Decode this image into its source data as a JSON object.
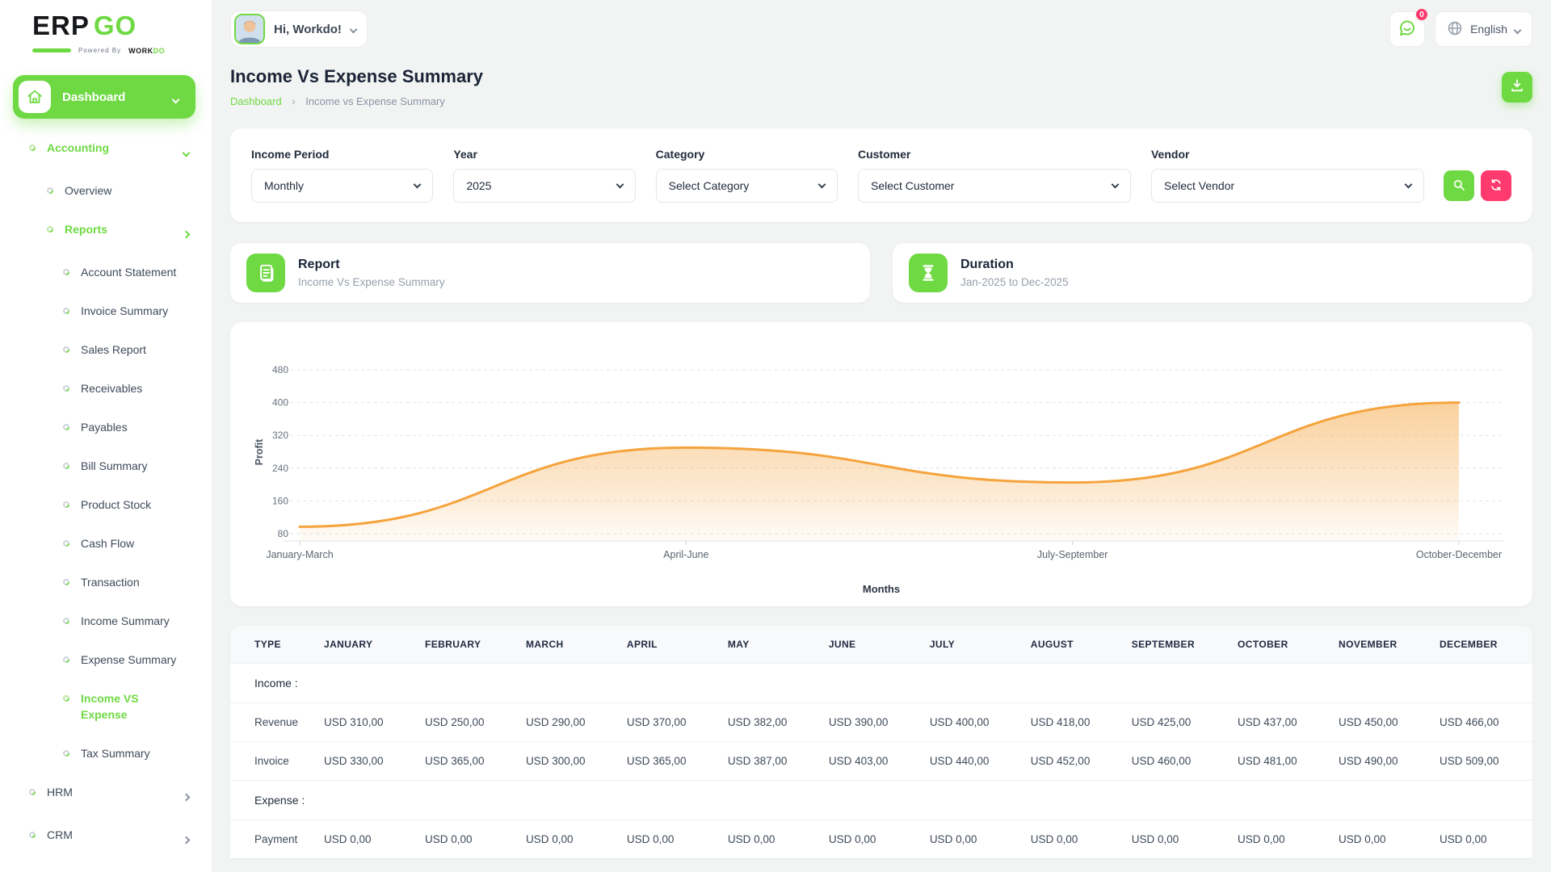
{
  "colors": {
    "primary": "#6fd943",
    "danger": "#ff3a6e",
    "chart_line": "#f5a33c",
    "grid": "#e2e4e6",
    "tick_text": "#6a7280"
  },
  "brand": {
    "erp": "ERP",
    "go": "GO",
    "powered_prefix": "Powered By",
    "powered_work": "WORK",
    "powered_do": "DO"
  },
  "header": {
    "greeting": "Hi, Workdo!",
    "notification_count": "0",
    "language": "English"
  },
  "sidebar": {
    "dashboard_label": "Dashboard",
    "items": [
      {
        "label": "Accounting",
        "level": 1,
        "active": true,
        "chevron": "down"
      },
      {
        "label": "Overview",
        "level": 2
      },
      {
        "label": "Reports",
        "level": 2,
        "active": true,
        "chevron": "right"
      },
      {
        "label": "Account Statement",
        "level": 3
      },
      {
        "label": "Invoice Summary",
        "level": 3
      },
      {
        "label": "Sales Report",
        "level": 3
      },
      {
        "label": "Receivables",
        "level": 3
      },
      {
        "label": "Payables",
        "level": 3
      },
      {
        "label": "Bill Summary",
        "level": 3
      },
      {
        "label": "Product Stock",
        "level": 3
      },
      {
        "label": "Cash Flow",
        "level": 3
      },
      {
        "label": "Transaction",
        "level": 3
      },
      {
        "label": "Income Summary",
        "level": 3
      },
      {
        "label": "Expense Summary",
        "level": 3
      },
      {
        "label": "Income VS Expense",
        "level": 3,
        "active": true
      },
      {
        "label": "Tax Summary",
        "level": 3
      },
      {
        "label": "HRM",
        "level": 1,
        "chevron": "right"
      },
      {
        "label": "CRM",
        "level": 1,
        "chevron": "right"
      }
    ]
  },
  "page": {
    "title": "Income Vs Expense Summary",
    "breadcrumb_home": "Dashboard",
    "breadcrumb_separator": "›",
    "breadcrumb_current": "Income vs Expense Summary"
  },
  "filters": {
    "fields": [
      {
        "label": "Income Period",
        "value": "Monthly"
      },
      {
        "label": "Year",
        "value": "2025"
      },
      {
        "label": "Category",
        "value": "Select Category"
      },
      {
        "label": "Customer",
        "value": "Select Customer"
      },
      {
        "label": "Vendor",
        "value": "Select Vendor"
      }
    ]
  },
  "cards": {
    "report": {
      "title": "Report",
      "subtitle": "Income Vs Expense Summary"
    },
    "duration": {
      "title": "Duration",
      "subtitle": "Jan-2025 to Dec-2025"
    }
  },
  "chart_data": {
    "type": "area",
    "x": [
      "January-March",
      "April-June",
      "July-September",
      "October-December"
    ],
    "series": [
      {
        "name": "Profit",
        "values": [
          97,
          290,
          205,
          400
        ]
      }
    ],
    "xlabel": "Months",
    "ylabel": "Profit",
    "yticks": [
      80,
      160,
      240,
      320,
      400,
      480
    ],
    "ylim": [
      60,
      520
    ],
    "grid": "dashed",
    "legend_position": "none"
  },
  "table": {
    "headers": [
      "TYPE",
      "JANUARY",
      "FEBRUARY",
      "MARCH",
      "APRIL",
      "MAY",
      "JUNE",
      "JULY",
      "AUGUST",
      "SEPTEMBER",
      "OCTOBER",
      "NOVEMBER",
      "DECEMBER"
    ],
    "sections": [
      {
        "label": "Income :",
        "rows": [
          {
            "type": "Revenue",
            "values": [
              "USD 310,00",
              "USD 250,00",
              "USD 290,00",
              "USD 370,00",
              "USD 382,00",
              "USD 390,00",
              "USD 400,00",
              "USD 418,00",
              "USD 425,00",
              "USD 437,00",
              "USD 450,00",
              "USD 466,00"
            ]
          },
          {
            "type": "Invoice",
            "values": [
              "USD 330,00",
              "USD 365,00",
              "USD 300,00",
              "USD 365,00",
              "USD 387,00",
              "USD 403,00",
              "USD 440,00",
              "USD 452,00",
              "USD 460,00",
              "USD 481,00",
              "USD 490,00",
              "USD 509,00"
            ]
          }
        ]
      },
      {
        "label": "Expense :",
        "rows": [
          {
            "type": "Payment",
            "values": [
              "USD 0,00",
              "USD 0,00",
              "USD 0,00",
              "USD 0,00",
              "USD 0,00",
              "USD 0,00",
              "USD 0,00",
              "USD 0,00",
              "USD 0,00",
              "USD 0,00",
              "USD 0,00",
              "USD 0,00"
            ]
          }
        ]
      }
    ]
  }
}
